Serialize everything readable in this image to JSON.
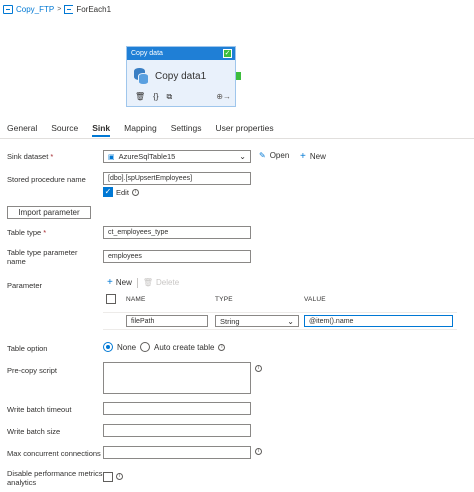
{
  "breadcrumb": {
    "pipeline": "Copy_FTP",
    "separator": ">",
    "activity": "ForEach1"
  },
  "card": {
    "header": "Copy data",
    "title": "Copy data1"
  },
  "tabs": [
    "General",
    "Source",
    "Sink",
    "Mapping",
    "Settings",
    "User properties"
  ],
  "sink": {
    "dataset_label": "Sink dataset",
    "required": "*",
    "dataset_value": "AzureSqlTable15",
    "open_label": "Open",
    "new_label": "New",
    "sp_label": "Stored procedure name",
    "sp_value": "[dbo].[spUpsertEmployees]",
    "edit_label": "Edit",
    "import_label": "Import parameter",
    "table_type_label": "Table type",
    "table_type_value": "ct_employees_type",
    "tt_param_label": "Table type parameter name",
    "tt_param_value": "employees",
    "parameter_label": "Parameter",
    "param_new": "New",
    "param_delete": "Delete",
    "col_name": "NAME",
    "col_type": "TYPE",
    "col_value": "VALUE",
    "param_row": {
      "name": "filePath",
      "type": "String",
      "value": "@item().name"
    },
    "table_option_label": "Table option",
    "opt_none": "None",
    "opt_auto": "Auto create table",
    "precopy_label": "Pre-copy script",
    "batch_timeout_label": "Write batch timeout",
    "batch_size_label": "Write batch size",
    "max_conn_label": "Max concurrent connections",
    "perf_label": "Disable performance metrics analytics"
  },
  "colors": {
    "accent": "#0078d4",
    "card_header": "#1f7fd6",
    "success": "#3dbd3d"
  }
}
